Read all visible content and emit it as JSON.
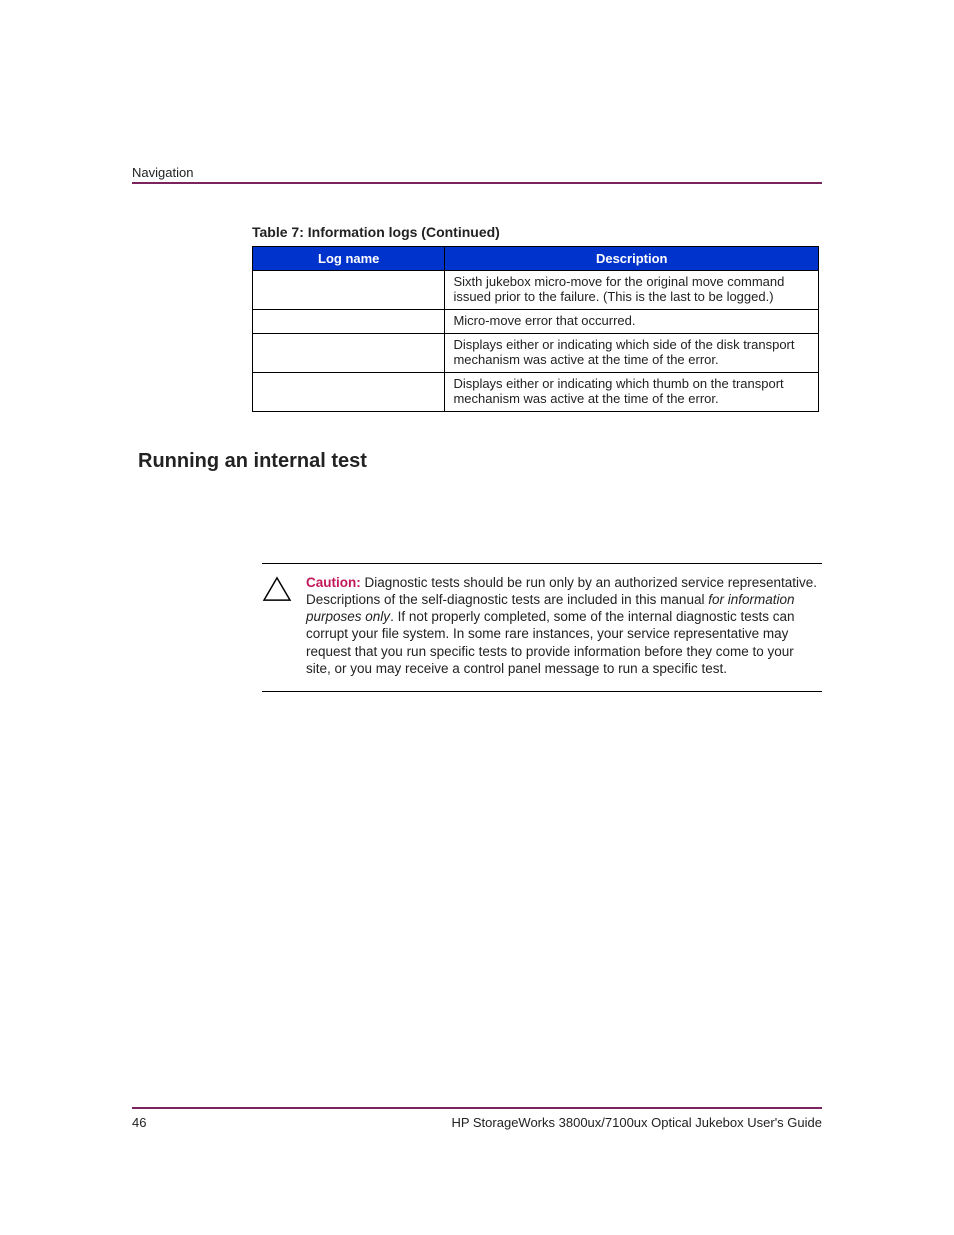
{
  "header": {
    "section": "Navigation"
  },
  "table": {
    "caption": "Table 7:  Information logs (Continued)",
    "col1": "Log name",
    "col2": "Description",
    "rows": [
      {
        "log": "",
        "desc": "Sixth jukebox micro-move for the original move command issued prior to the failure. (This is the last to be logged.)"
      },
      {
        "log": "",
        "desc": "Micro-move error that occurred."
      },
      {
        "log": "",
        "desc": "Displays either       or           indicating which side of the disk transport mechanism was active at the time of the error."
      },
      {
        "log": "",
        "desc": "Displays either       or           indicating which thumb on the transport mechanism was active at the time of the error."
      }
    ]
  },
  "heading": "Running an internal test",
  "caution": {
    "label": "Caution:",
    "part1": "Diagnostic tests should be run only by an authorized service representative. Descriptions of the self-diagnostic tests are included in this manual ",
    "italic": "for information purposes only",
    "part2": ". If not properly completed, some of the internal diagnostic tests can corrupt your file system. In some rare instances, your service representative may request that you run specific tests to provide information before they come to your site, or you may receive a control panel message to run a specific test."
  },
  "footer": {
    "page": "46",
    "title": "HP StorageWorks 3800ux/7100ux Optical Jukebox User's Guide"
  }
}
